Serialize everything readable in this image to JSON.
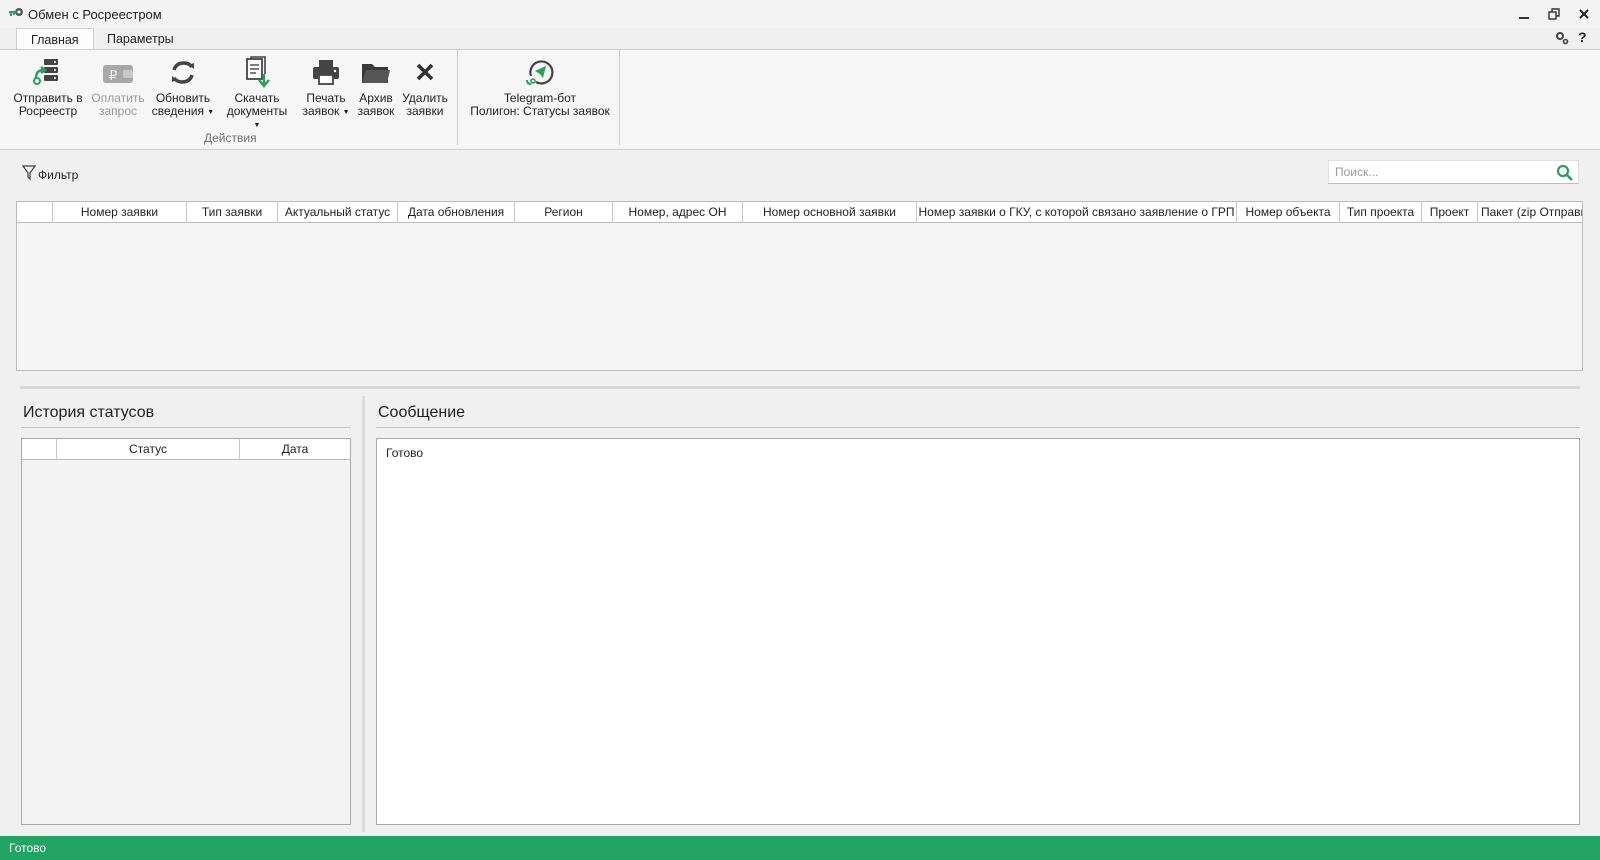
{
  "window": {
    "title": "Обмен с Росреестром",
    "icons": [
      "app-key-icon",
      "minimize-icon",
      "restore-icon",
      "close-icon"
    ]
  },
  "tabs": [
    {
      "label": "Главная",
      "active": true
    },
    {
      "label": "Параметры",
      "active": false
    }
  ],
  "ribbon": {
    "actions_group_label": "Действия",
    "buttons": [
      {
        "line1": "Отправить в",
        "line2": "Росреестр",
        "icon": "send-server-icon",
        "disabled": false
      },
      {
        "line1": "Оплатить",
        "line2": "запрос",
        "icon": "wallet-ruble-icon",
        "disabled": true
      },
      {
        "line1": "Обновить",
        "line2": "сведения",
        "icon": "refresh-icon",
        "disabled": false,
        "dropdown": true
      },
      {
        "line1": "Скачать",
        "line2": "документы",
        "icon": "download-document-icon",
        "disabled": false,
        "dropdown": true
      },
      {
        "line1": "Печать",
        "line2": "заявок",
        "icon": "printer-icon",
        "disabled": false,
        "dropdown": true
      },
      {
        "line1": "Архив",
        "line2": "заявок",
        "icon": "folder-icon",
        "disabled": false
      },
      {
        "line1": "Удалить",
        "line2": "заявки",
        "icon": "delete-x-icon",
        "disabled": false
      }
    ],
    "telegram": {
      "line1": "Telegram-бот",
      "line2": "Полигон: Статусы заявок",
      "icon": "telegram-bot-icon"
    }
  },
  "toolbar": {
    "filter_label": "Фильтр",
    "search_placeholder": "Поиск..."
  },
  "main_grid": {
    "columns": [
      "",
      "Номер заявки",
      "Тип заявки",
      "Актуальный статус",
      "Дата обновления",
      "Регион",
      "Номер, адрес ОН",
      "Номер основной заявки",
      "Номер заявки о ГКУ, с которой связано заявление о ГРП",
      "Номер объекта",
      "Тип проекта",
      "Проект",
      "Пакет (zip Отправитель"
    ],
    "rows": []
  },
  "history": {
    "title": "История статусов",
    "columns": [
      "",
      "Статус",
      "Дата"
    ],
    "rows": []
  },
  "message": {
    "title": "Сообщение",
    "text": "Готово"
  },
  "statusbar": {
    "text": "Готово",
    "color": "#22a464"
  },
  "colors": {
    "accent_green": "#2e9e5b",
    "status_green": "#22a464"
  }
}
